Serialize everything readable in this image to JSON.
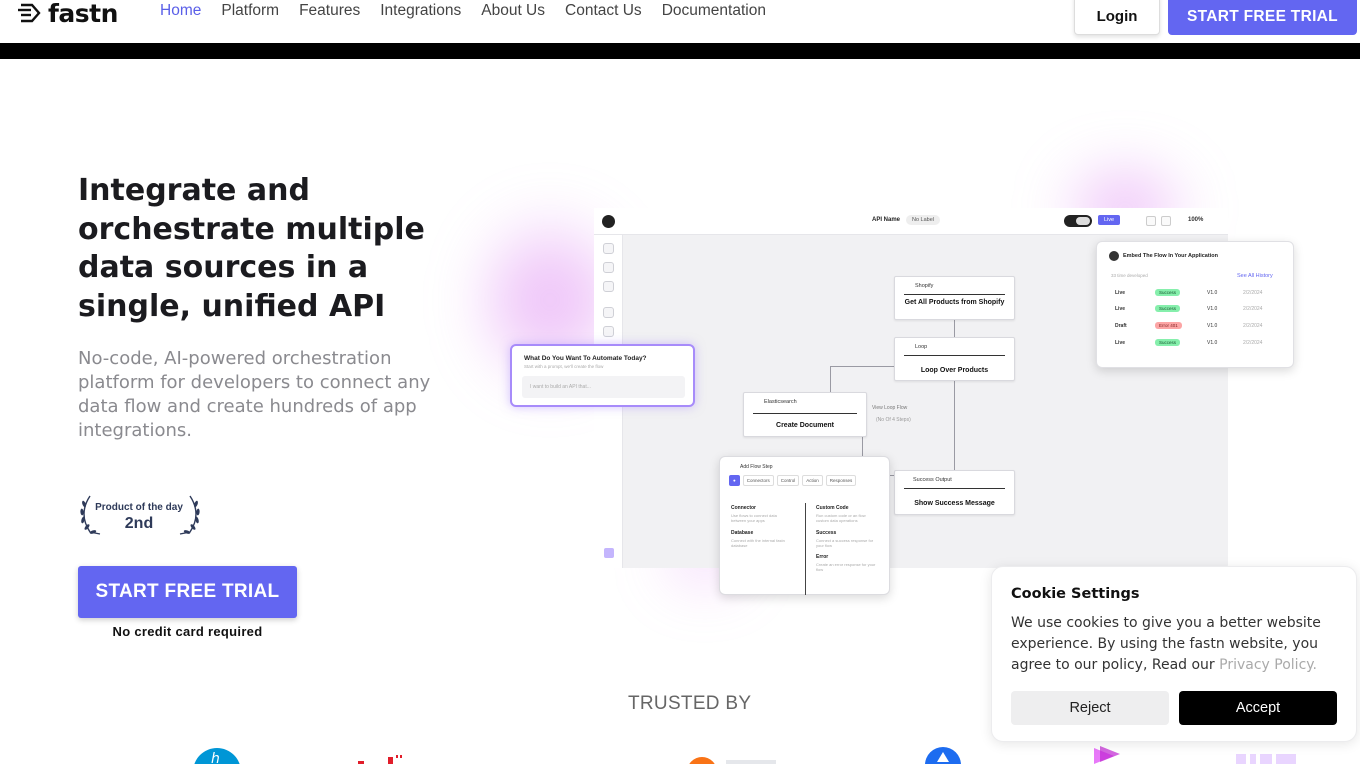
{
  "header": {
    "brand": "fastn",
    "nav": [
      {
        "label": "Home",
        "active": true
      },
      {
        "label": "Platform"
      },
      {
        "label": "Features"
      },
      {
        "label": "Integrations"
      },
      {
        "label": "About Us"
      },
      {
        "label": "Contact Us"
      },
      {
        "label": "Documentation"
      }
    ],
    "login_label": "Login",
    "trial_label": "START FREE TRIAL"
  },
  "hero": {
    "title": "Integrate and orchestrate multiple data sources in a single, unified API",
    "subtitle": "No-code, AI-powered orchestration platform for developers to connect any data flow and create hundreds of app integrations.",
    "badge_top": "Product of the day",
    "badge_rank": "2nd",
    "cta_label": "START FREE TRIAL",
    "cta_note": "No credit card required"
  },
  "mockup": {
    "api_name_label": "API Name",
    "no_label": "No Label",
    "live_label": "Live",
    "zoom": "100%",
    "nodes": {
      "shopify_head": "Shopify",
      "shopify_title": "Get All Products from Shopify",
      "loop_head": "Loop",
      "loop_title": "Loop Over Products",
      "elastic_head": "Elasticsearch",
      "elastic_title": "Create Document",
      "view_loop_flow": "View Loop Flow",
      "no_of_steps": "(No Of 4 Steps)",
      "success_head": "Success Output",
      "success_title": "Show Success Message"
    },
    "automate": {
      "title": "What Do You Want To Automate Today?",
      "hint": "Start with a prompt, we'll create the flow",
      "placeholder": "I want to build an API that..."
    },
    "history": {
      "title": "Embed The Flow In Your Application",
      "subtitle": "33 time developed",
      "see_all": "See All History",
      "rows": [
        {
          "env": "Live",
          "status": "Success",
          "ok": true,
          "ver": "V1.0",
          "date": "2/2/2024"
        },
        {
          "env": "Live",
          "status": "Success",
          "ok": true,
          "ver": "V1.0",
          "date": "2/2/2024"
        },
        {
          "env": "Draft",
          "status": "Error 401",
          "ok": false,
          "ver": "V1.0",
          "date": "2/2/2024"
        },
        {
          "env": "Live",
          "status": "Success",
          "ok": true,
          "ver": "V1.0",
          "date": "2/2/2024"
        }
      ]
    },
    "add_step": {
      "title": "Add Flow Step",
      "tabs": [
        "Connectors",
        "Control",
        "Action",
        "Responses"
      ],
      "options": [
        {
          "name": "Connector",
          "desc": "Use flows to connect data between your apps"
        },
        {
          "name": "Custom Code",
          "desc": "Run custom code or an flow custom data operations"
        },
        {
          "name": "Database",
          "desc": "Connect with the internal fastn database"
        },
        {
          "name": "Success",
          "desc": "Connect a success response for your flow"
        },
        {
          "name": "Error",
          "desc": "Create an error response for your flow"
        }
      ]
    }
  },
  "trusted": {
    "label": "TRUSTED BY"
  },
  "cookie": {
    "title": "Cookie Settings",
    "text": "We use cookies to give you a better website experience. By using the fastn website, you agree to our policy, Read our ",
    "link": "Privacy Policy.",
    "reject_label": "Reject",
    "accept_label": "Accept"
  },
  "colors": {
    "accent": "#6366f1",
    "nav_active": "#5a5fe8",
    "black_bar": "#000000"
  }
}
